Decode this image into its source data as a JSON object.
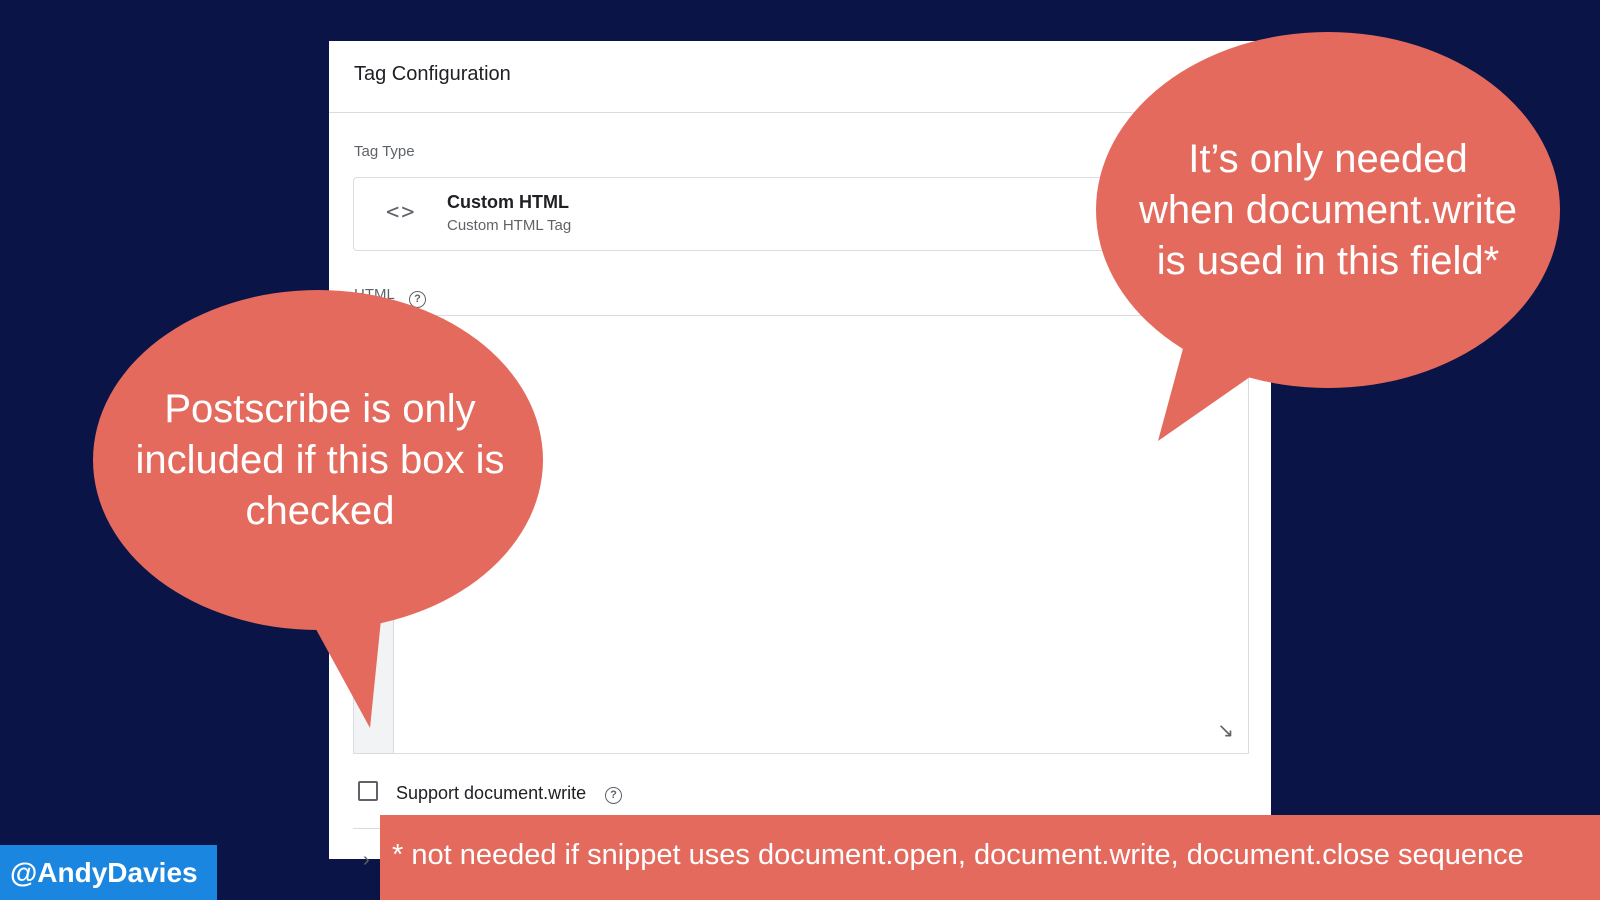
{
  "panel": {
    "title": "Tag Configuration",
    "tag_type_label": "Tag Type",
    "tag_type_icon": "code-icon",
    "tag_type_name": "Custom HTML",
    "tag_type_subtitle": "Custom HTML Tag",
    "html_label": "HTML",
    "help_glyph": "?",
    "checkbox_label": "Support document.write",
    "checkbox_checked": false
  },
  "callouts": {
    "right": [
      "It’s only needed",
      "when document.write",
      "is used in this field*"
    ],
    "left": [
      "Postscribe is only",
      "included if this box is",
      "checked"
    ]
  },
  "footnote": "* not needed if snippet uses document.open, document.write, document.close sequence",
  "author_handle": "@AndyDavies",
  "colors": {
    "background": "#0b1446",
    "callout": "#e46a5e",
    "handle_badge": "#1a86e0"
  }
}
